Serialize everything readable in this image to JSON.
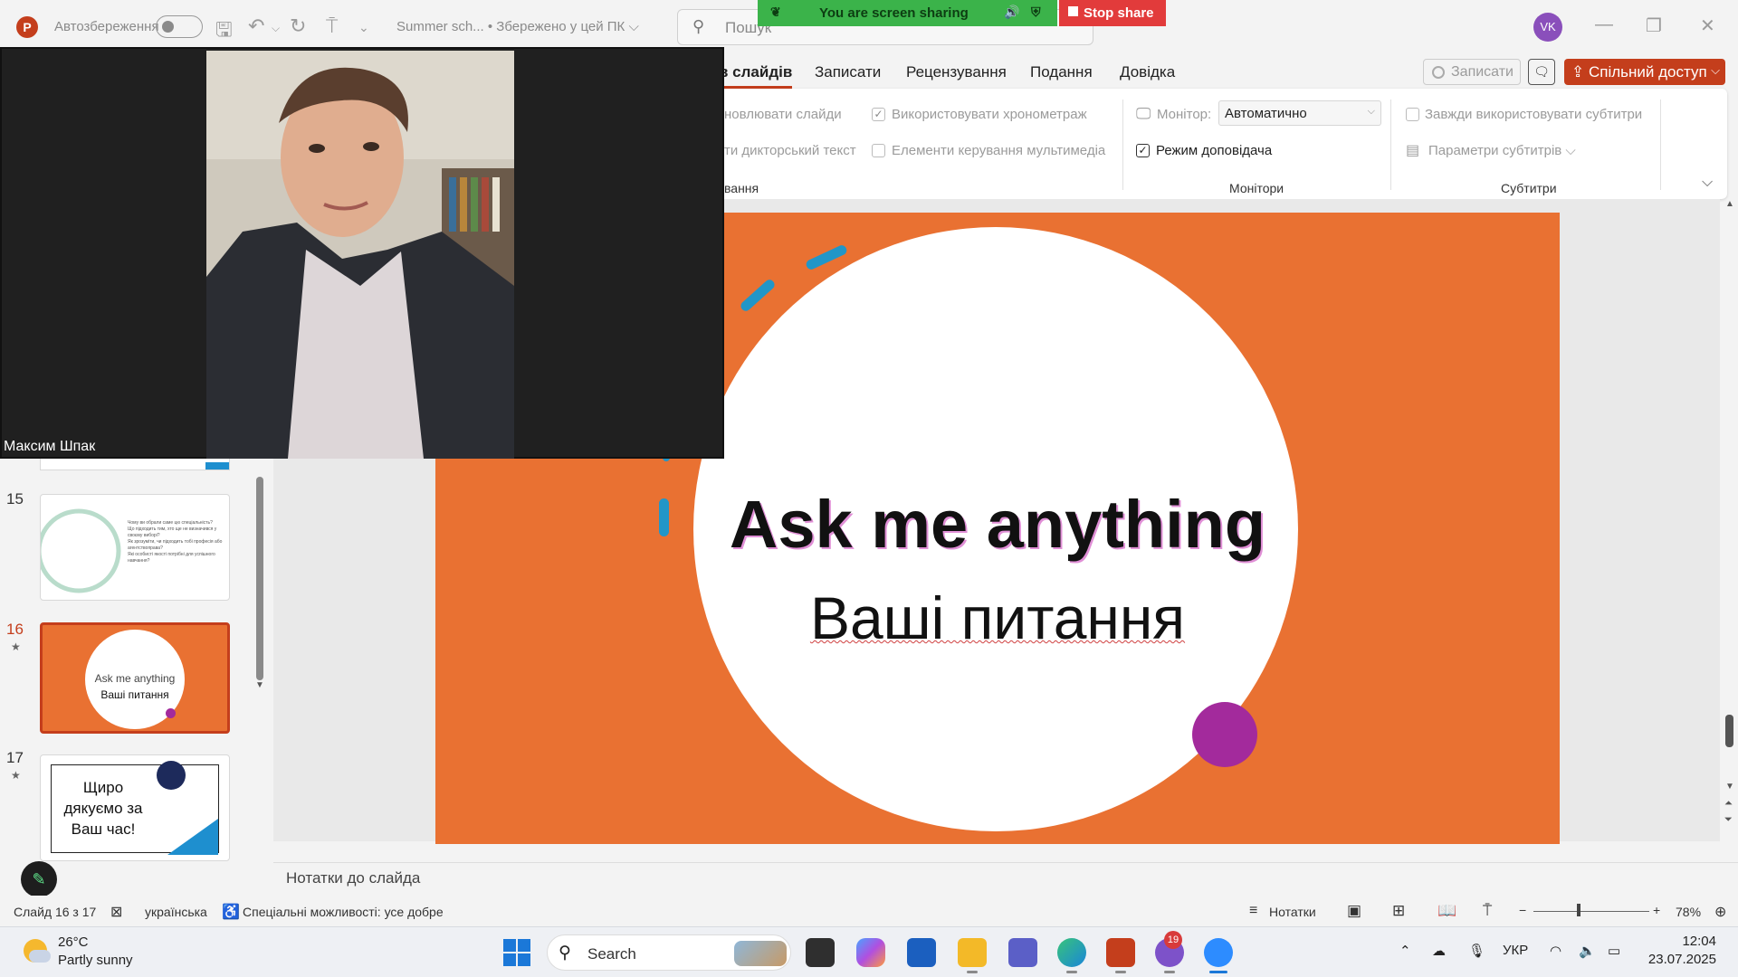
{
  "titlebar": {
    "app_icon": "P",
    "autosave_label": "Автозбереження",
    "doc_title": "Summer sch... • Збережено у цей ПК ⌵",
    "search_placeholder": "Пошук",
    "avatar_initials": "VK"
  },
  "screen_share": {
    "status_text": "You are screen sharing",
    "stop_label": "Stop share"
  },
  "ribbon": {
    "tabs": [
      "в слайдів",
      "Записати",
      "Рецензування",
      "Подання",
      "Довідка"
    ],
    "active_tab_index": 0,
    "record_label": "Записати",
    "share_label": "Спільний доступ",
    "group1": {
      "item1": "новлювати слайди",
      "item2": "ти дикторський текст",
      "label": "вання"
    },
    "group2": {
      "use_timings": "Використовувати хронометраж",
      "media_controls": "Елементи керування мультимедіа"
    },
    "monitors": {
      "monitor_label": "Монітор:",
      "monitor_value": "Автоматично",
      "presenter_view": "Режим доповідача",
      "label": "Монітори"
    },
    "subtitles": {
      "always_use": "Завжди використовувати субтитри",
      "settings": "Параметри субтитрів ⌵",
      "label": "Субтитри"
    }
  },
  "video": {
    "participant_name": "Максим Шпак"
  },
  "thumbnails": [
    {
      "num": "15",
      "star": "",
      "bullets": [
        "Чому ви обрали саме цю спеціальність?",
        "Що підходить тим, хто ще не визначився у своєму виборі?",
        "Як зрозуміти, чи підходить тобі професія або агентствоправа?",
        "Які особисті якості потрібні для успішного навчання?"
      ]
    },
    {
      "num": "16",
      "star": "★",
      "title": "Ask me anything",
      "subtitle": "Ваші питання"
    },
    {
      "num": "17",
      "star": "★",
      "text": "Щиро дякуємо за Ваш час!"
    }
  ],
  "slide": {
    "title": "Ask me anything",
    "subtitle": "Ваші питання",
    "colors": {
      "background": "#e97132",
      "accent_dot": "#a32a9c",
      "dashes": "#2196c8"
    }
  },
  "notes": {
    "placeholder": "Нотатки до слайда"
  },
  "statusbar": {
    "slide_counter": "Слайд 16 з 17",
    "language": "українська",
    "accessibility": "Спеціальні можливості: усе добре",
    "notes_button": "Нотатки",
    "zoom": "78%"
  },
  "taskbar": {
    "temperature": "26°C",
    "condition": "Partly sunny",
    "search_label": "Search",
    "viber_badge": "19",
    "language": "УКР",
    "time": "12:04",
    "date": "23.07.2025"
  }
}
